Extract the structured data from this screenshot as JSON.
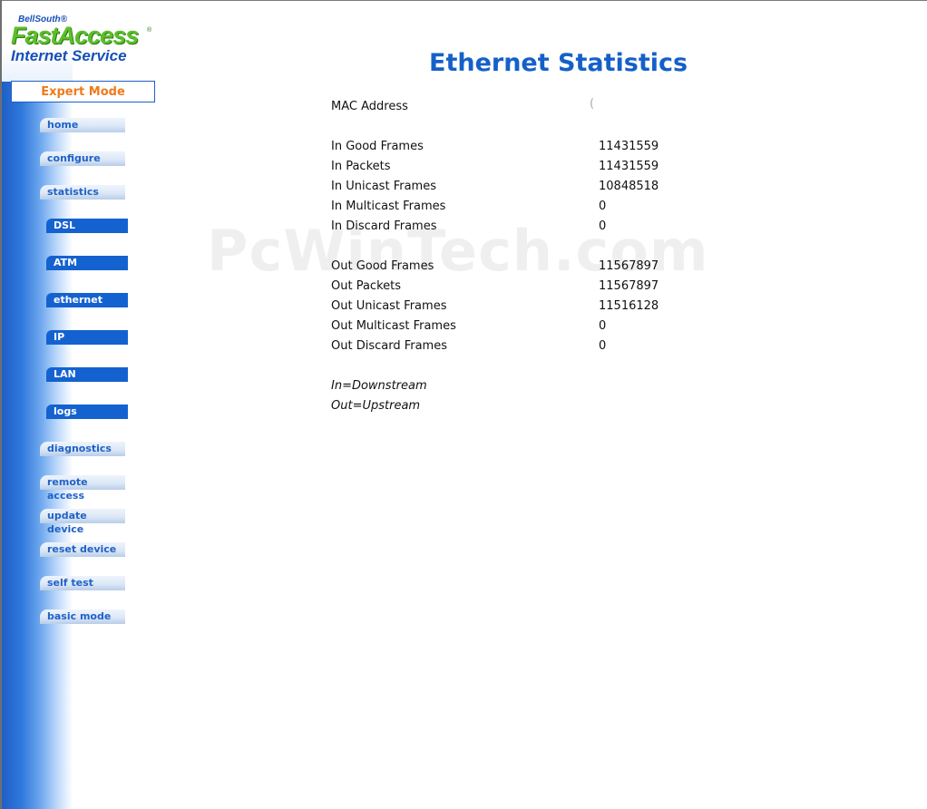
{
  "logo": {
    "line1": "BellSouth®",
    "line2": "FastAccess",
    "line2_mark": "®",
    "line3": "Internet Service"
  },
  "mode": "Expert Mode",
  "nav": {
    "home": "home",
    "configure": "configure",
    "statistics": "statistics",
    "sub": {
      "dsl": "DSL",
      "atm": "ATM",
      "ethernet": "ethernet",
      "ip": "IP",
      "lan": "LAN",
      "logs": "logs"
    },
    "diagnostics": "diagnostics",
    "remote_access": "remote access",
    "update_device": "update device",
    "reset_device": "reset device",
    "self_test": "self test",
    "basic_mode": "basic mode"
  },
  "page_title": "Ethernet Statistics",
  "mac": {
    "label": "MAC Address",
    "value": "("
  },
  "stats": [
    {
      "label": "In Good Frames",
      "value": "11431559"
    },
    {
      "label": "In Packets",
      "value": "11431559"
    },
    {
      "label": "In Unicast Frames",
      "value": "10848518"
    },
    {
      "label": "In Multicast Frames",
      "value": "0"
    },
    {
      "label": "In Discard Frames",
      "value": "0"
    },
    {
      "label": "Out Good Frames",
      "value": "11567897"
    },
    {
      "label": "Out Packets",
      "value": "11567897"
    },
    {
      "label": "Out Unicast Frames",
      "value": "11516128"
    },
    {
      "label": "Out Multicast Frames",
      "value": "0"
    },
    {
      "label": "Out Discard Frames",
      "value": "0"
    }
  ],
  "notes": {
    "in": "In=Downstream",
    "out": "Out=Upstream"
  },
  "watermark": "PcWinTech.com",
  "colors": {
    "title_blue": "#1560c8",
    "mode_orange": "#ef7a1a",
    "sub_nav_blue": "#1462d0",
    "logo_green": "#5cbf2a"
  }
}
